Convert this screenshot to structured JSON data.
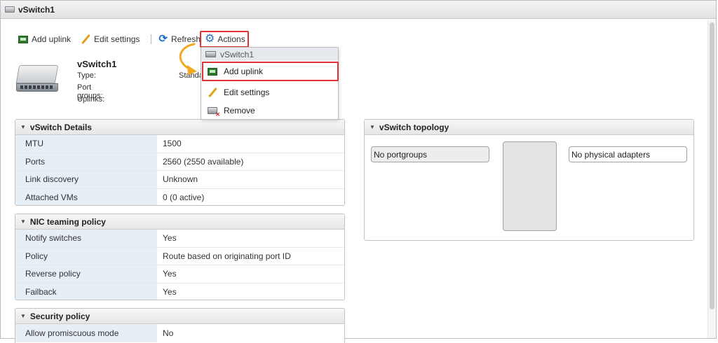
{
  "window": {
    "title": "vSwitch1"
  },
  "toolbar": {
    "add_uplink": "Add uplink",
    "edit_settings": "Edit settings",
    "refresh": "Refresh",
    "actions": "Actions"
  },
  "header": {
    "name": "vSwitch1",
    "type_label": "Type:",
    "type_value": "Standa",
    "portgroups_label": "Port groups:",
    "uplinks_label": "Uplinks:"
  },
  "menu": {
    "header": "vSwitch1",
    "items": [
      {
        "label": "Add uplink",
        "icon": "uplink-icon"
      },
      {
        "label": "Edit settings",
        "icon": "pencil-icon"
      },
      {
        "label": "Remove",
        "icon": "remove-icon"
      }
    ]
  },
  "details": {
    "title": "vSwitch Details",
    "rows": [
      {
        "key": "MTU",
        "value": "1500"
      },
      {
        "key": "Ports",
        "value": "2560 (2550 available)"
      },
      {
        "key": "Link discovery",
        "value": "Unknown"
      },
      {
        "key": "Attached VMs",
        "value": "0 (0 active)"
      }
    ]
  },
  "teaming": {
    "title": "NIC teaming policy",
    "rows": [
      {
        "key": "Notify switches",
        "value": "Yes"
      },
      {
        "key": "Policy",
        "value": "Route based on originating port ID"
      },
      {
        "key": "Reverse policy",
        "value": "Yes"
      },
      {
        "key": "Failback",
        "value": "Yes"
      }
    ]
  },
  "security": {
    "title": "Security policy",
    "rows": [
      {
        "key": "Allow promiscuous mode",
        "value": "No"
      }
    ]
  },
  "topology": {
    "title": "vSwitch topology",
    "portgroups": "No portgroups",
    "adapters": "No physical adapters"
  },
  "colors": {
    "highlight": "#e0313b",
    "arrow": "#f0a81e",
    "key_bg": "#e6eef6"
  }
}
